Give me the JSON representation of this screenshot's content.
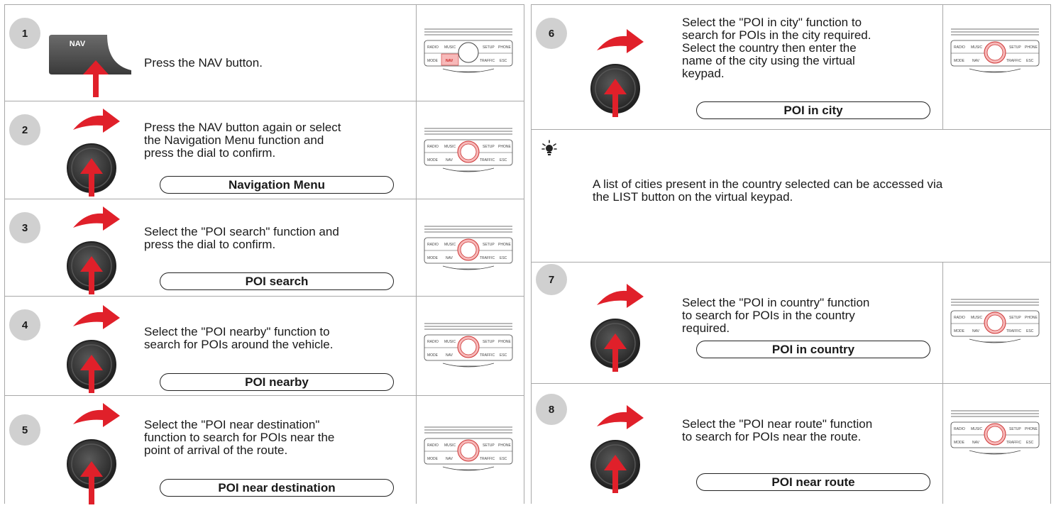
{
  "steps": [
    {
      "num": "1",
      "lines": [
        "Press the NAV button."
      ],
      "pill": ""
    },
    {
      "num": "2",
      "lines": [
        "Press the NAV button again or select",
        "the Navigation Menu function and",
        "press the dial to confirm."
      ],
      "pill": "Navigation Menu"
    },
    {
      "num": "3",
      "lines": [
        "Select the \"POI search\" function and",
        "press the dial to confirm."
      ],
      "pill": "POI search"
    },
    {
      "num": "4",
      "lines": [
        "Select the \"POI nearby\" function to",
        "search for POIs around the vehicle."
      ],
      "pill": "POI nearby"
    },
    {
      "num": "5",
      "lines": [
        "Select the \"POI near destination\"",
        "function to search for POIs near the",
        "point of arrival of the route."
      ],
      "pill": "POI near destination"
    },
    {
      "num": "6",
      "lines": [
        "Select the \"POI in city\" function to",
        "search for POIs in the city required.",
        "Select the country then enter the",
        "name of the city using the virtual",
        "keypad."
      ],
      "pill": "POI in city"
    },
    {
      "num": "7",
      "lines": [
        "Select the \"POI in country\" function",
        "to search for POIs in the country",
        "required."
      ],
      "pill": "POI in country"
    },
    {
      "num": "8",
      "lines": [
        "Select the \"POI near route\" function",
        "to search for POIs near the route."
      ],
      "pill": "POI near route"
    }
  ],
  "tip": {
    "icon": "lightbulb-icon",
    "lines": [
      "A list of cities present in the country selected can be accessed via",
      "the LIST button on the virtual keypad."
    ]
  },
  "nav_key_label": "NAV",
  "console_labels": {
    "radio": "RADIO",
    "music": "MUSIC",
    "setup": "SETUP",
    "phone": "PHONE",
    "mode": "MODE",
    "nav": "NAV",
    "traffic": "TRAFFIC",
    "esc": "ESC"
  },
  "colors": {
    "arrow": "#e0202a",
    "dial_dark": "#3a3a3a",
    "highlight": "#f7b9b9",
    "badge": "#d0d0d0"
  }
}
